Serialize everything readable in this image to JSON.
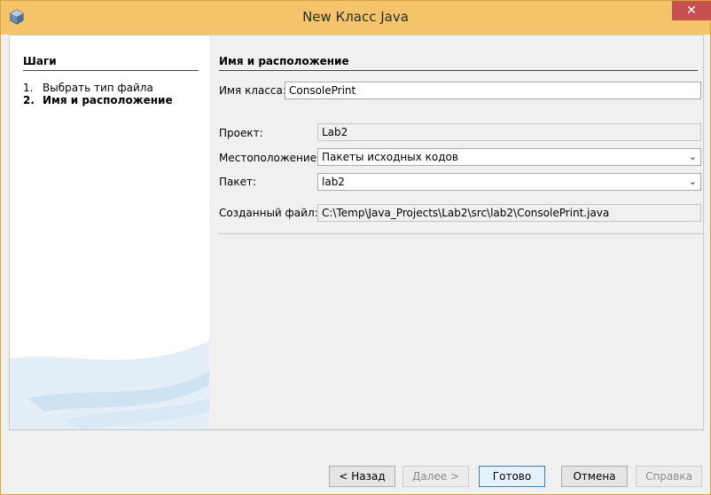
{
  "window": {
    "title": "New Класс Java",
    "close_glyph": "✕"
  },
  "steps": {
    "heading": "Шаги",
    "items": [
      {
        "num": "1.",
        "label": "Выбрать тип файла"
      },
      {
        "num": "2.",
        "label": "Имя и расположение"
      }
    ]
  },
  "form": {
    "heading": "Имя и расположение",
    "class_name": {
      "label": "Имя класса:",
      "value": "ConsolePrint"
    },
    "project": {
      "label": "Проект:",
      "value": "Lab2"
    },
    "location": {
      "label": "Местоположение:",
      "value": "Пакеты исходных кодов"
    },
    "package": {
      "label": "Пакет:",
      "value": "lab2"
    },
    "created_file": {
      "label": "Созданный файл:",
      "value": "C:\\Temp\\Java_Projects\\Lab2\\src\\lab2\\ConsolePrint.java"
    }
  },
  "buttons": {
    "back": "< Назад",
    "next": "Далее >",
    "finish": "Готово",
    "cancel": "Отмена",
    "help": "Справка"
  },
  "icons": {
    "app": "netbeans-cube-icon",
    "dropdown": "chevron-down-icon"
  },
  "colors": {
    "titlebar": "#f4c46a",
    "close": "#c75050",
    "default_button": "#3c7fb1"
  }
}
